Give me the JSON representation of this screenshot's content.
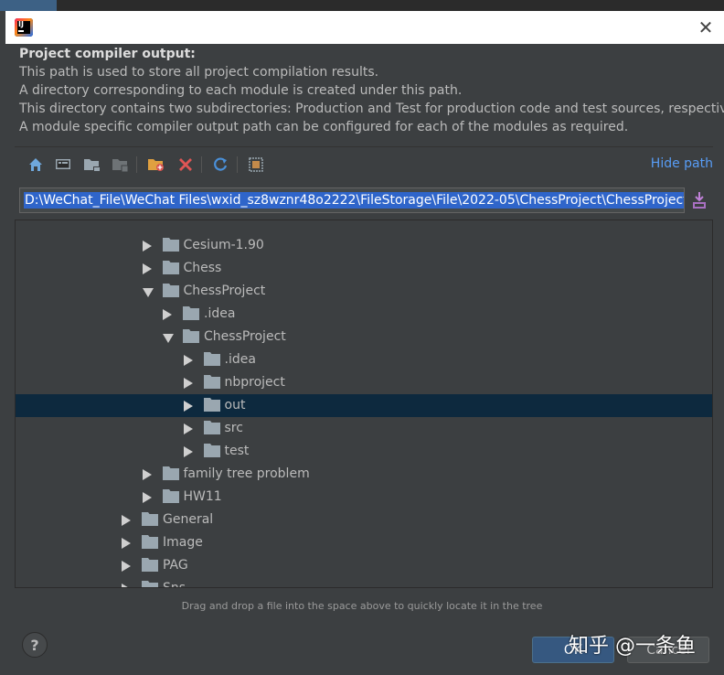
{
  "description": {
    "heading": "Project compiler output:",
    "lines": [
      "This path is used to store all project compilation results.",
      "A directory corresponding to each module is created under this path.",
      "This directory contains two subdirectories: Production and Test for production code and test sources, respectively.",
      "A module specific compiler output path can be configured for each of the modules as required."
    ]
  },
  "toolbar": {
    "hide_path_label": "Hide path",
    "icons": [
      "home-icon",
      "desktop-icon",
      "project-folder-icon",
      "module-folder-icon",
      "new-folder-icon",
      "delete-icon",
      "refresh-icon",
      "show-hidden-icon"
    ]
  },
  "path": {
    "value": "D:\\WeChat_File\\WeChat Files\\wxid_sz8wznr48o2222\\FileStorage\\File\\2022-05\\ChessProject\\ChessProject\\out"
  },
  "tree": {
    "rows": [
      {
        "label": "Cesium-1.90",
        "level": 3,
        "expanded": false,
        "selected": false
      },
      {
        "label": "Chess",
        "level": 3,
        "expanded": false,
        "selected": false
      },
      {
        "label": "ChessProject",
        "level": 3,
        "expanded": true,
        "selected": false
      },
      {
        "label": ".idea",
        "level": 4,
        "expanded": false,
        "selected": false
      },
      {
        "label": "ChessProject",
        "level": 4,
        "expanded": true,
        "selected": false
      },
      {
        "label": ".idea",
        "level": 5,
        "expanded": false,
        "selected": false
      },
      {
        "label": "nbproject",
        "level": 5,
        "expanded": false,
        "selected": false
      },
      {
        "label": "out",
        "level": 5,
        "expanded": false,
        "selected": true
      },
      {
        "label": "src",
        "level": 5,
        "expanded": false,
        "selected": false
      },
      {
        "label": "test",
        "level": 5,
        "expanded": false,
        "selected": false
      },
      {
        "label": "family tree problem",
        "level": 3,
        "expanded": false,
        "selected": false
      },
      {
        "label": "HW11",
        "level": 3,
        "expanded": false,
        "selected": false
      },
      {
        "label": "General",
        "level": 2,
        "expanded": false,
        "selected": false
      },
      {
        "label": "Image",
        "level": 2,
        "expanded": false,
        "selected": false
      },
      {
        "label": "PAG",
        "level": 2,
        "expanded": false,
        "selected": false
      },
      {
        "label": "Sns",
        "level": 2,
        "expanded": false,
        "selected": false
      }
    ]
  },
  "hint": "Drag and drop a file into the space above to quickly locate it in the tree",
  "buttons": {
    "help": "?",
    "ok": "OK",
    "cancel": "Cancel"
  },
  "watermark": "知乎 @一条鱼",
  "colors": {
    "background": "#3c3f41",
    "selection": "#0d293e",
    "link": "#589df6",
    "path_highlight": "#2f65ca",
    "ok_button": "#365880"
  }
}
